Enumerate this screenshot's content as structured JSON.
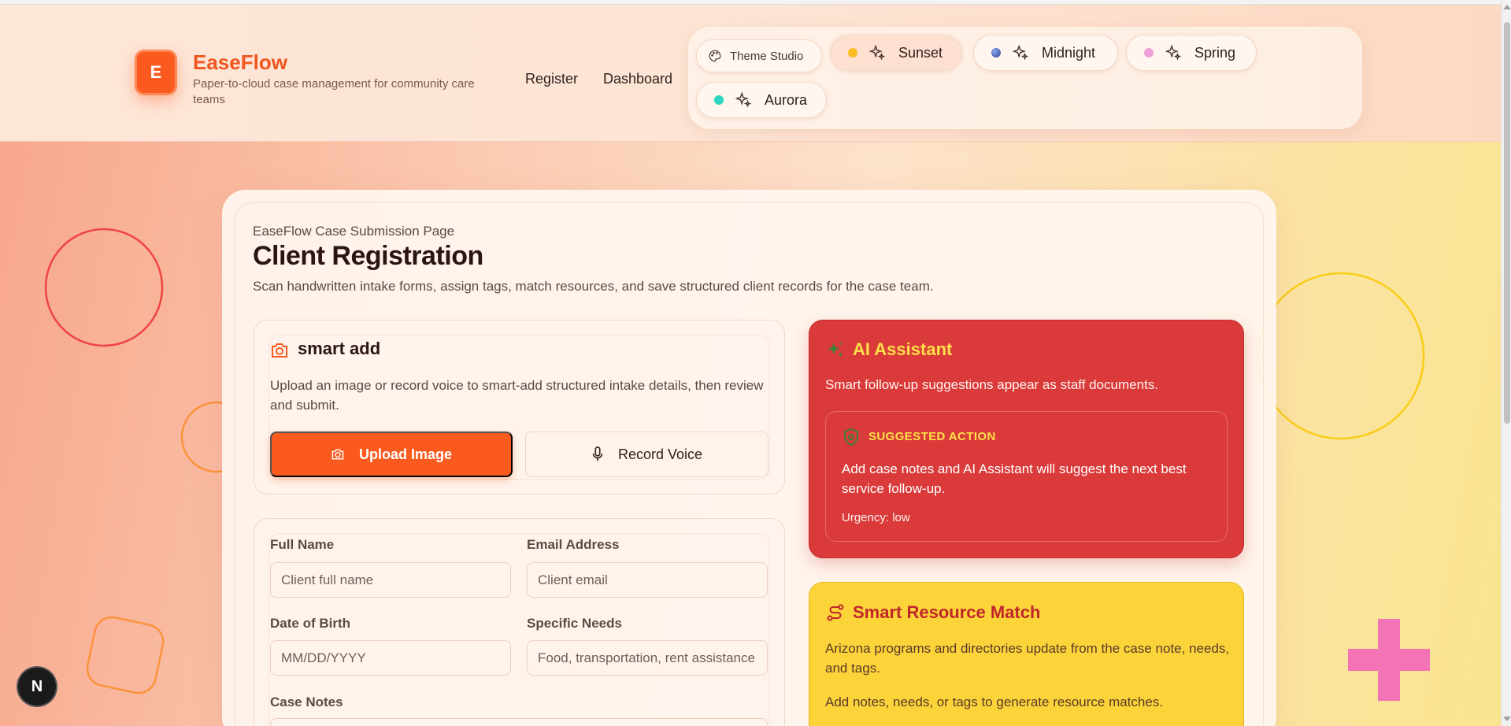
{
  "brand": {
    "logo_letter": "E",
    "name": "EaseFlow",
    "tagline": "Paper-to-cloud case management for community care teams"
  },
  "nav": {
    "register": "Register",
    "dashboard": "Dashboard"
  },
  "themes": {
    "studio_label": "Theme Studio",
    "options": [
      {
        "label": "Sunset",
        "color": "#fbbf24",
        "active": true
      },
      {
        "label": "Midnight",
        "color": "#3b5bb5",
        "active": false
      },
      {
        "label": "Spring",
        "color": "#f0a0d8",
        "active": false
      },
      {
        "label": "Aurora",
        "color": "#2dd4bf",
        "active": false
      }
    ]
  },
  "page": {
    "eyebrow": "EaseFlow Case Submission Page",
    "title": "Client Registration",
    "subtitle": "Scan handwritten intake forms, assign tags, match resources, and save structured client records for the case team."
  },
  "smart_add": {
    "title": "smart add",
    "description": "Upload an image or record voice to smart-add structured intake details, then review and submit.",
    "upload_label": "Upload Image",
    "record_label": "Record Voice"
  },
  "form": {
    "full_name": {
      "label": "Full Name",
      "placeholder": "Client full name",
      "value": ""
    },
    "email": {
      "label": "Email Address",
      "placeholder": "Client email",
      "value": ""
    },
    "dob": {
      "label": "Date of Birth",
      "placeholder": "MM/DD/YYYY",
      "value": ""
    },
    "needs": {
      "label": "Specific Needs",
      "placeholder": "Food, transportation, rent assistance",
      "value": ""
    },
    "notes": {
      "label": "Case Notes"
    }
  },
  "ai_assistant": {
    "title": "AI Assistant",
    "description": "Smart follow-up suggestions appear as staff documents.",
    "suggested_label": "SUGGESTED ACTION",
    "suggestion": "Add case notes and AI Assistant will suggest the next best service follow-up.",
    "urgency": "Urgency: low"
  },
  "resource_match": {
    "title": "Smart Resource Match",
    "description": "Arizona programs and directories update from the case note, needs, and tags.",
    "empty": "Add notes, needs, or tags to generate resource matches."
  },
  "dev_badge": "N",
  "colors": {
    "accent": "#fb5a1e",
    "ai_card": "#da3a3a",
    "resource_card": "#fcd43a",
    "highlight": "#fde047"
  }
}
